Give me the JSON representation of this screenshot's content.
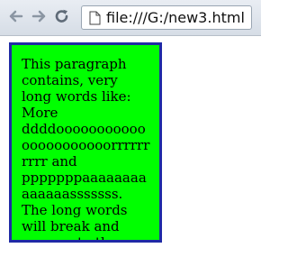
{
  "browser": {
    "address": "file:///G:/new3.html",
    "back_icon": "back-arrow-icon",
    "forward_icon": "forward-arrow-icon",
    "reload_icon": "reload-icon",
    "page_icon": "document-icon"
  },
  "paragraph": {
    "text": "This paragraph contains, very long words like: More ddddoooooooooooooooooooooorrrrrrrrrr and pppppppaaaaaaaaaaaaaasssssss. The long words will break and wrap onto the next line."
  },
  "colors": {
    "box_background": "#00ff00",
    "box_border": "#1f2aa5"
  }
}
